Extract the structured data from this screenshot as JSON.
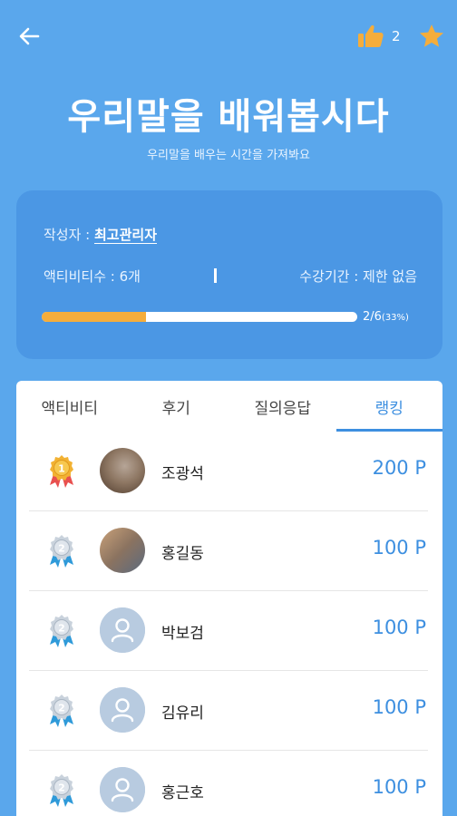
{
  "header": {
    "like_count": "2"
  },
  "course": {
    "title": "우리말을 배워봅시다",
    "subtitle": "우리말을 배우는 시간을 가져봐요",
    "author_label": "작성자 : ",
    "author_name": "최고관리자",
    "activity_count": "액티비티수 : 6개",
    "period": "수강기간 : 제한 없음",
    "progress": {
      "fraction": 0.33,
      "text": "2/6",
      "percent": "(33%)",
      "fill_color": "#f5ad3b"
    }
  },
  "tabs": [
    {
      "label": "액티비티"
    },
    {
      "label": "후기"
    },
    {
      "label": "질의응답"
    },
    {
      "label": "랭킹"
    }
  ],
  "active_tab": "랭킹",
  "ranking": [
    {
      "rank": "1",
      "name": "조광석",
      "points": "200 P",
      "avatar": "photo"
    },
    {
      "rank": "2",
      "name": "홍길동",
      "points": "100 P",
      "avatar": "photo"
    },
    {
      "rank": "2",
      "name": "박보검",
      "points": "100 P",
      "avatar": "default-user-icon"
    },
    {
      "rank": "2",
      "name": "김유리",
      "points": "100 P",
      "avatar": "default-user-icon"
    },
    {
      "rank": "2",
      "name": "홍근호",
      "points": "100 P",
      "avatar": "default-user-icon"
    }
  ],
  "colors": {
    "background": "#5aa7ec",
    "card": "#4b97e4",
    "accent": "#3d8fe0",
    "gold": "#f2b233",
    "silver": "#c9d2dc"
  }
}
